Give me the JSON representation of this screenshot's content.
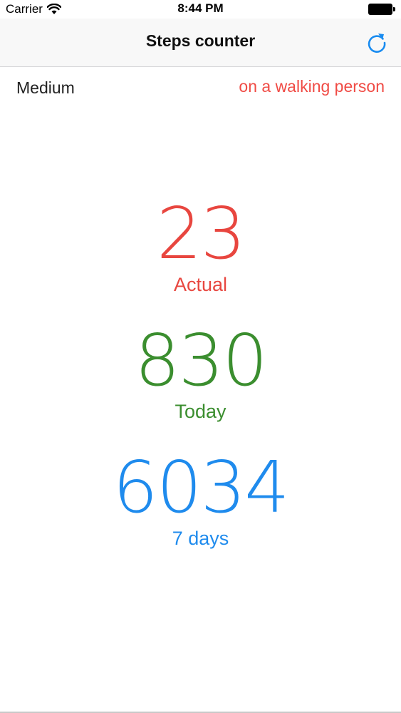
{
  "status_bar": {
    "carrier": "Carrier",
    "time": "8:44 PM",
    "wifi_icon": "wifi-icon",
    "battery_icon": "battery-icon"
  },
  "nav": {
    "title": "Steps counter",
    "refresh_icon": "refresh-icon",
    "accent_color": "#1a8cf0"
  },
  "activity": {
    "confidence": "Medium",
    "type": "on a walking person",
    "type_color": "#f04b45"
  },
  "counters": {
    "actual": {
      "value": "23",
      "label": "Actual",
      "color": "#e8463f"
    },
    "today": {
      "value": "830",
      "label": "Today",
      "color": "#3b8e2f"
    },
    "week": {
      "value": "6034",
      "label": "7 days",
      "color": "#1f8bed"
    }
  }
}
